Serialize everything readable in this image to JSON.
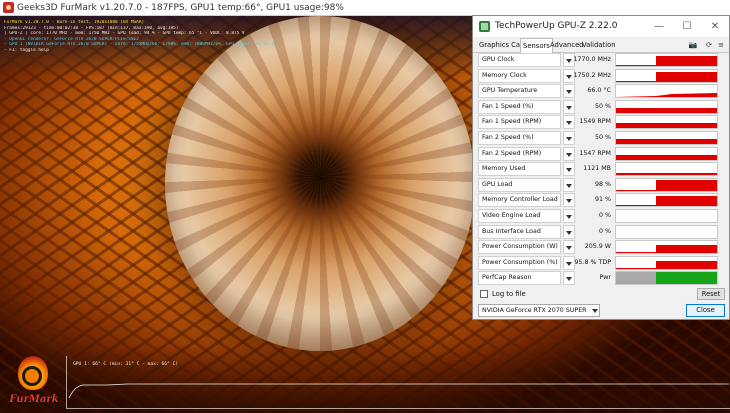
{
  "furmark": {
    "title": "Geeks3D FurMark v1.20.7.0 - 187FPS, GPU1 temp:66°, GPU1 usage:98%",
    "osd": [
      {
        "text": "FurMark v1.20.7.0 - Burn-in test, 1920x1080 (0X MSAA)",
        "color": "yellow"
      },
      {
        "text": "Frames:29123 - time:00:02:38 - FPS:187 (min:137, max:190, avg:185)",
        "color": "white"
      },
      {
        "text": "[ GPU-Z ] core: 1770 MHz - mem: 1750 MHz - GPU load: 94 % - GPU temp: 65 °C - VDDC: 0.875 V",
        "color": "white"
      },
      {
        "text": "- OpenGL renderer: GeForce RTX 2070 SUPER/PCIe/SSE2",
        "color": "cyan"
      },
      {
        "text": "- GPU 1 (NVIDIA GeForce RTX 2070 SUPER) - core: 1755MHz/66° C/98%, mem: 7000MHz/6%, GPU power: 91.5% TDP, limits[power:1, temp:0, volt:0, OV:0]",
        "color": "cyan"
      },
      {
        "text": "- F1: toggle help",
        "color": "white"
      }
    ],
    "graph_label": "GPU 1: 66° C (min: 31° C - max: 66° C)",
    "logo_text": "FurMark"
  },
  "gpuz": {
    "title": "TechPowerUp GPU-Z 2.22.0",
    "window_buttons": {
      "minimize": "—",
      "maximize": "☐",
      "close": "✕"
    },
    "tabs": [
      "Graphics Card",
      "Sensors",
      "Advanced",
      "Validation"
    ],
    "active_tab": "Sensors",
    "toolbar": {
      "camera": "📷",
      "refresh": "⟳",
      "menu": "≡"
    },
    "sensors": [
      {
        "name": "GPU Clock",
        "value": "1770.0 MHz",
        "graph": "high-step",
        "level": 0.82
      },
      {
        "name": "Memory Clock",
        "value": "1750.2 MHz",
        "graph": "high-step",
        "level": 0.82
      },
      {
        "name": "GPU Temperature",
        "value": "66.0 °C",
        "graph": "ramp",
        "level": 0.6
      },
      {
        "name": "Fan 1 Speed (%)",
        "value": "50 %",
        "graph": "full",
        "level": 0.45
      },
      {
        "name": "Fan 1 Speed (RPM)",
        "value": "1549 RPM",
        "graph": "full",
        "level": 0.45
      },
      {
        "name": "Fan 2 Speed (%)",
        "value": "50 %",
        "graph": "full",
        "level": 0.45
      },
      {
        "name": "Fan 2 Speed (RPM)",
        "value": "1547 RPM",
        "graph": "full",
        "level": 0.45
      },
      {
        "name": "Memory Used",
        "value": "1121 MB",
        "graph": "line",
        "level": 0.15
      },
      {
        "name": "GPU Load",
        "value": "98 %",
        "graph": "high-step",
        "level": 0.92
      },
      {
        "name": "Memory Controller Load",
        "value": "91 %",
        "graph": "high-step",
        "level": 0.85
      },
      {
        "name": "Video Engine Load",
        "value": "0 %",
        "graph": "none",
        "level": 0
      },
      {
        "name": "Bus Interface Load",
        "value": "0 %",
        "graph": "none",
        "level": 0
      },
      {
        "name": "Power Consumption (W)",
        "value": "205.9 W",
        "graph": "high-step",
        "level": 0.7
      },
      {
        "name": "Power Consumption (%)",
        "value": "95.8 % TDP",
        "graph": "high-step",
        "level": 0.7
      },
      {
        "name": "PerfCap Reason",
        "value": "Pwr",
        "graph": "perfcap",
        "level": 1
      }
    ],
    "log_to_file": "Log to file",
    "reset_button": "Reset",
    "gpu_selected": "NVIDIA GeForce RTX 2070 SUPER",
    "close_button": "Close",
    "colors": {
      "graph": "#e00000",
      "perfcap_green": "#16a516",
      "perfcap_grey": "#a8a8a8"
    }
  }
}
